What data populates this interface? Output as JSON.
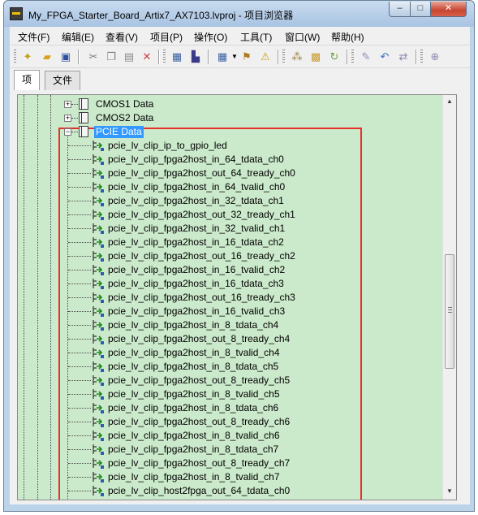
{
  "window": {
    "title": "My_FPGA_Starter_Board_Artix7_AX7103.lvproj - 项目浏览器",
    "min_glyph": "‒",
    "max_glyph": "□",
    "close_glyph": "✕"
  },
  "menu": [
    "文件(F)",
    "编辑(E)",
    "查看(V)",
    "项目(P)",
    "操作(O)",
    "工具(T)",
    "窗口(W)",
    "帮助(H)"
  ],
  "tabs": [
    "项",
    "文件"
  ],
  "tree": {
    "items": [
      {
        "label": "CMOS1 Data",
        "type": "folder",
        "expander": "+"
      },
      {
        "label": "CMOS2 Data",
        "type": "folder",
        "expander": "+"
      },
      {
        "label": "PCIE Data",
        "type": "folder",
        "expander": "−",
        "selected": true
      }
    ],
    "children": [
      "pcie_lv_clip_ip_to_gpio_led",
      "pcie_lv_clip_fpga2host_in_64_tdata_ch0",
      "pcie_lv_clip_fpga2host_out_64_tready_ch0",
      "pcie_lv_clip_fpga2host_in_64_tvalid_ch0",
      "pcie_lv_clip_fpga2host_in_32_tdata_ch1",
      "pcie_lv_clip_fpga2host_out_32_tready_ch1",
      "pcie_lv_clip_fpga2host_in_32_tvalid_ch1",
      "pcie_lv_clip_fpga2host_in_16_tdata_ch2",
      "pcie_lv_clip_fpga2host_out_16_tready_ch2",
      "pcie_lv_clip_fpga2host_in_16_tvalid_ch2",
      "pcie_lv_clip_fpga2host_in_16_tdata_ch3",
      "pcie_lv_clip_fpga2host_out_16_tready_ch3",
      "pcie_lv_clip_fpga2host_in_16_tvalid_ch3",
      "pcie_lv_clip_fpga2host_in_8_tdata_ch4",
      "pcie_lv_clip_fpga2host_out_8_tready_ch4",
      "pcie_lv_clip_fpga2host_in_8_tvalid_ch4",
      "pcie_lv_clip_fpga2host_in_8_tdata_ch5",
      "pcie_lv_clip_fpga2host_out_8_tready_ch5",
      "pcie_lv_clip_fpga2host_in_8_tvalid_ch5",
      "pcie_lv_clip_fpga2host_in_8_tdata_ch6",
      "pcie_lv_clip_fpga2host_out_8_tready_ch6",
      "pcie_lv_clip_fpga2host_in_8_tvalid_ch6",
      "pcie_lv_clip_fpga2host_in_8_tdata_ch7",
      "pcie_lv_clip_fpga2host_out_8_tready_ch7",
      "pcie_lv_clip_fpga2host_in_8_tvalid_ch7",
      "pcie_lv_clip_host2fpga_out_64_tdata_ch0"
    ]
  },
  "toolbar_icons": [
    "new-item-icon",
    "open-icon",
    "save-all-icon",
    "cut-icon",
    "copy-icon",
    "paste-icon",
    "delete-icon",
    "build-icon",
    "deploy-icon",
    "view-options-icon",
    "dependencies-icon",
    "warning-icon",
    "group-icon",
    "package-icon",
    "refresh-icon",
    "edit-icon",
    "undo-icon",
    "replace-icon",
    "add-icon"
  ],
  "colors": {
    "tree_background": "#cbe9cb",
    "highlight_box": "#e8302a",
    "selection": "#3399ff"
  }
}
